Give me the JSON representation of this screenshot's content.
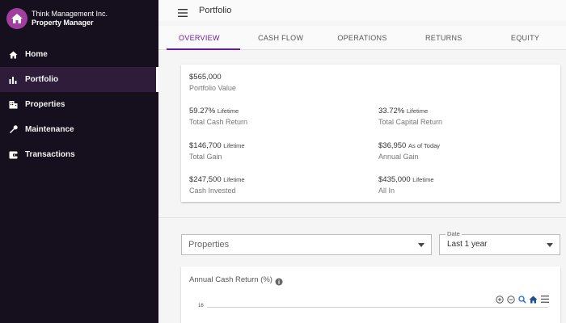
{
  "sidebar": {
    "company": "Think Management Inc.",
    "role": "Property Manager",
    "items": [
      {
        "label": "Home",
        "icon": "home-icon"
      },
      {
        "label": "Portfolio",
        "icon": "bar-chart-icon",
        "active": true
      },
      {
        "label": "Properties",
        "icon": "building-icon"
      },
      {
        "label": "Maintenance",
        "icon": "wrench-icon"
      },
      {
        "label": "Transactions",
        "icon": "wallet-icon"
      }
    ]
  },
  "header": {
    "title": "Portfolio"
  },
  "tabs": [
    "OVERVIEW",
    "CASH FLOW",
    "OPERATIONS",
    "RETURNS",
    "EQUITY"
  ],
  "summary": {
    "portfolio_value": {
      "value": "$565,000",
      "label": "Portfolio Value"
    },
    "total_cash_return": {
      "value": "59.27%",
      "suffix": "Lifetime",
      "label": "Total Cash Return"
    },
    "total_capital_return": {
      "value": "33.72%",
      "suffix": "Lifetime",
      "label": "Total Capital Return"
    },
    "total_gain": {
      "value": "$146,700",
      "suffix": "Lifetime",
      "label": "Total Gain"
    },
    "annual_gain": {
      "value": "$36,950",
      "suffix": "As of Today",
      "label": "Annual Gain"
    },
    "cash_invested": {
      "value": "$247,500",
      "suffix": "Lifetime",
      "label": "Cash Invested"
    },
    "all_in": {
      "value": "$435,000",
      "suffix": "Lifetime",
      "label": "All In"
    }
  },
  "filters": {
    "properties_placeholder": "Properties",
    "date_label": "Date",
    "date_value": "Last 1 year"
  },
  "chart": {
    "title": "Annual Cash Return (%)",
    "y_tick_top": "16"
  },
  "colors": {
    "sidebar_bg": "#160f1d",
    "accent": "#6a1b9a",
    "logo": "#a03f9e"
  }
}
